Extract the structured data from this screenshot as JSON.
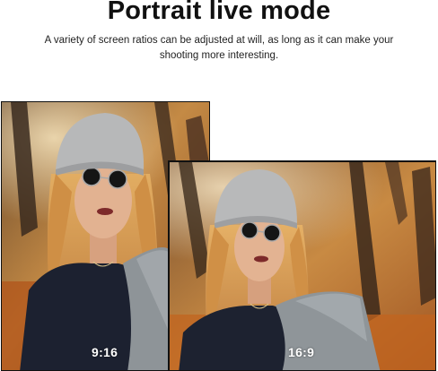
{
  "header": {
    "title": "Portrait live mode",
    "subtitle": "A variety of screen ratios can be adjusted at will, as long as it can make your shooting more interesting."
  },
  "photos": [
    {
      "ratio_label": "9:16"
    },
    {
      "ratio_label": "16:9"
    }
  ],
  "colors": {
    "background": "#ffffff",
    "title_text": "#111111",
    "label_text": "#ffffff",
    "autumn_orange": "#c9762e",
    "hat_gray": "#b8b9ba",
    "hair_blonde": "#d79a4f",
    "sweater_navy": "#1d2230",
    "coat_gray": "#8e9498"
  }
}
